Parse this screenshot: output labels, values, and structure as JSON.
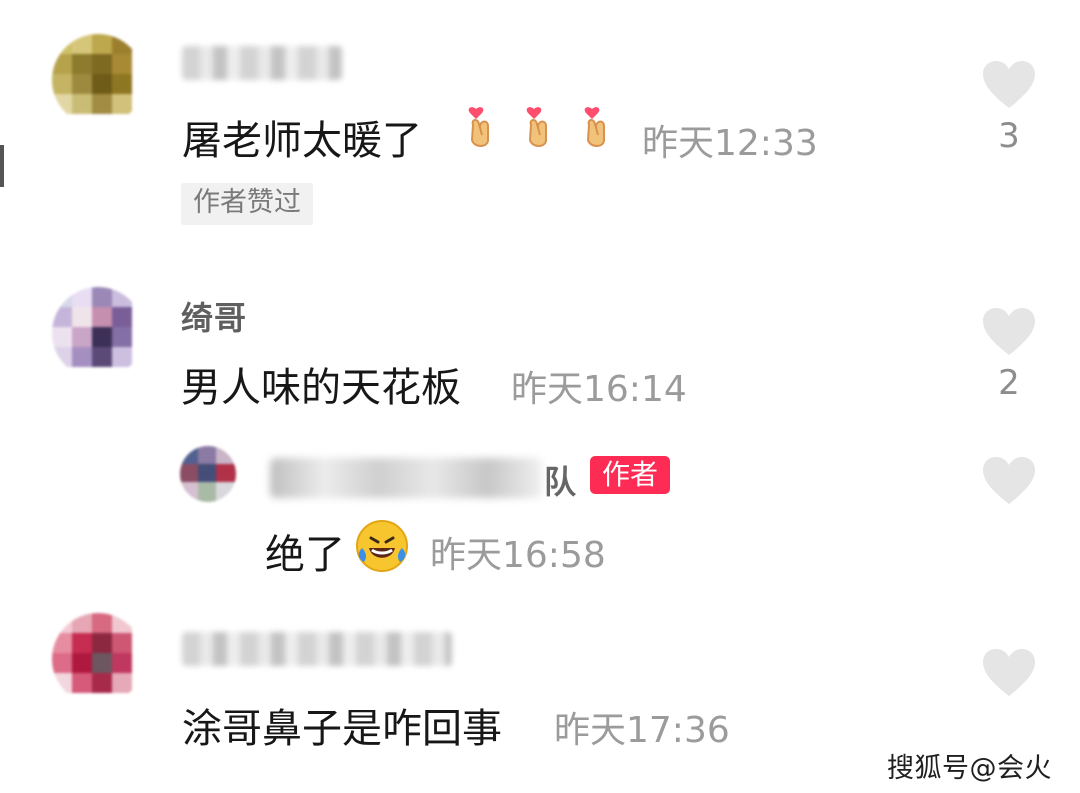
{
  "comments": [
    {
      "name": "",
      "text": "屠老师太暖了",
      "time": "昨天12:33",
      "likes": "3",
      "badge": "作者赞过"
    },
    {
      "name": "绮哥",
      "text": "男人味的天花板",
      "time": "昨天16:14",
      "likes": "2"
    },
    {
      "reply_name": "队",
      "author_badge": "作者",
      "text": "绝了",
      "time": "昨天16:58"
    },
    {
      "name": "",
      "text": "涂哥鼻子是咋回事",
      "time": "昨天17:36"
    }
  ],
  "watermark": "搜狐号@会火",
  "colors": {
    "author_badge": "#fe2c55",
    "time_text": "#9b9b9b",
    "like_icon": "#e5e5e5"
  },
  "icons": {
    "like": "heart-icon",
    "emoji": "finger-heart-emoji",
    "laugh": "laughing-emoji"
  }
}
